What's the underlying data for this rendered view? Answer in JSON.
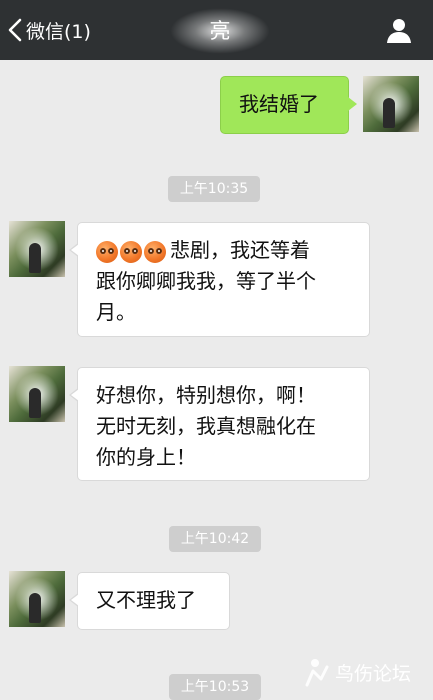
{
  "topbar": {
    "back_label": "微信(1)",
    "title": "亮"
  },
  "messages": [
    {
      "type": "text",
      "side": "right",
      "text": "我结婚了"
    },
    {
      "type": "time",
      "text": "上午10:35"
    },
    {
      "type": "text",
      "side": "left",
      "emoji_count": 3,
      "emoji_name": "sad-face-emoji",
      "lines": [
        "悲剧，我还等着",
        "跟你卿卿我我，等了半个",
        "月。"
      ]
    },
    {
      "type": "text",
      "side": "left",
      "lines": [
        "好想你，特别想你，啊！",
        "无时无刻，我真想融化在",
        "你的身上！"
      ]
    },
    {
      "type": "time",
      "text": "上午10:42"
    },
    {
      "type": "text",
      "side": "left",
      "text": "又不理我了"
    },
    {
      "type": "time",
      "text": "上午10:53"
    }
  ],
  "watermark": {
    "text": "鸟伤论坛"
  },
  "colors": {
    "topbar": "#2e3133",
    "background": "#ebebeb",
    "bubble_right": "#a0e759",
    "bubble_left": "#ffffff",
    "timestamp_bg": "#cecece"
  }
}
